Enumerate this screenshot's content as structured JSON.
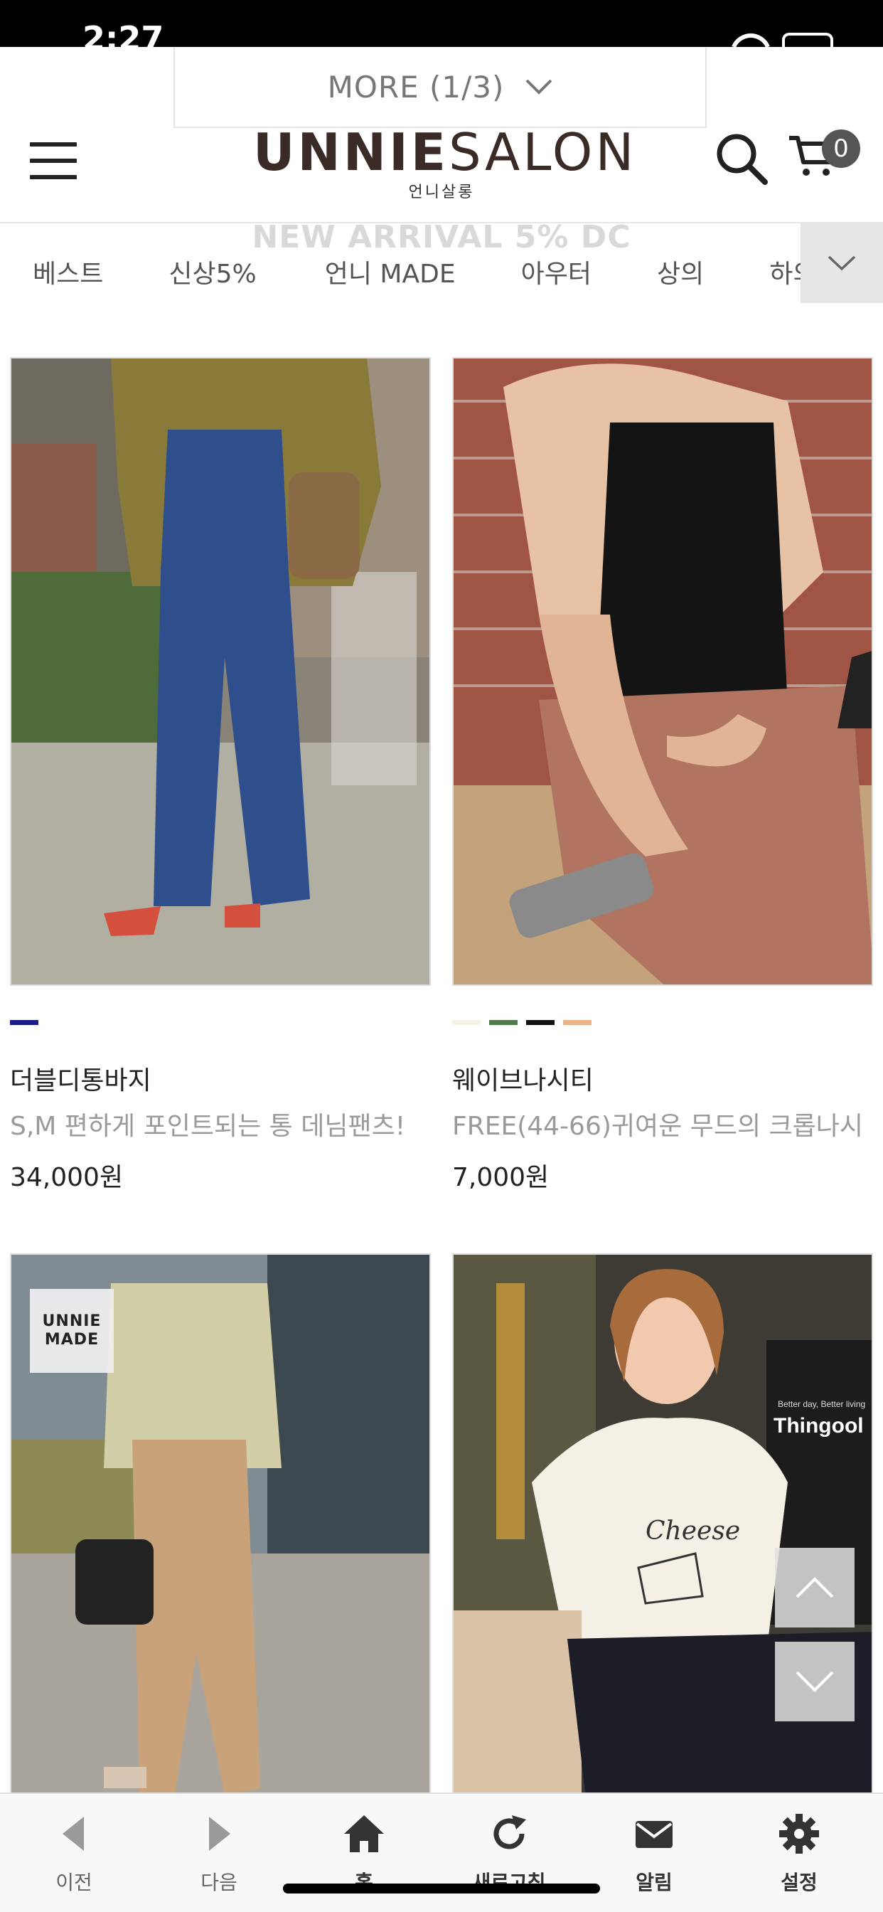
{
  "status_bar": {
    "time": "2:27"
  },
  "header": {
    "more_label": "MORE (1/3)",
    "logo_bold": "UNNIE",
    "logo_thin": "SALON",
    "logo_sub": "언니살롱",
    "cart_count": "0"
  },
  "category_nav": {
    "promo": "NEW ARRIVAL 5% DC",
    "items": [
      "베스트",
      "신상5%",
      "언니 MADE",
      "아우터",
      "상의",
      "하의"
    ]
  },
  "products": [
    {
      "name": "더블디통바지",
      "description": "S,M 편하게 포인트되는 통 데님팬츠!",
      "price": "34,000원",
      "swatches": [
        "#1a1a8c"
      ]
    },
    {
      "name": "웨이브나시티",
      "description": "FREE(44-66)귀여운 무드의 크롭나시",
      "price": "7,000원",
      "swatches": [
        "#f6f3e6",
        "#4e7a4e",
        "#111111",
        "#e8b28a"
      ]
    },
    {
      "badge_line1": "UNNIE",
      "badge_line2": "MADE"
    },
    {
      "shirt_text": "Cheese",
      "sign_text": "Thingool",
      "sign_small": "Better day, Better living"
    }
  ],
  "bottom_bar": {
    "tabs": [
      "이전",
      "다음",
      "홈",
      "새로고침",
      "알림",
      "설정"
    ]
  },
  "icons": [
    "menu-icon",
    "search-icon",
    "cart-icon",
    "chevron-down-icon",
    "chevron-up-icon",
    "back-arrow-icon",
    "forward-arrow-icon",
    "home-icon",
    "refresh-icon",
    "mail-icon",
    "gear-icon"
  ]
}
